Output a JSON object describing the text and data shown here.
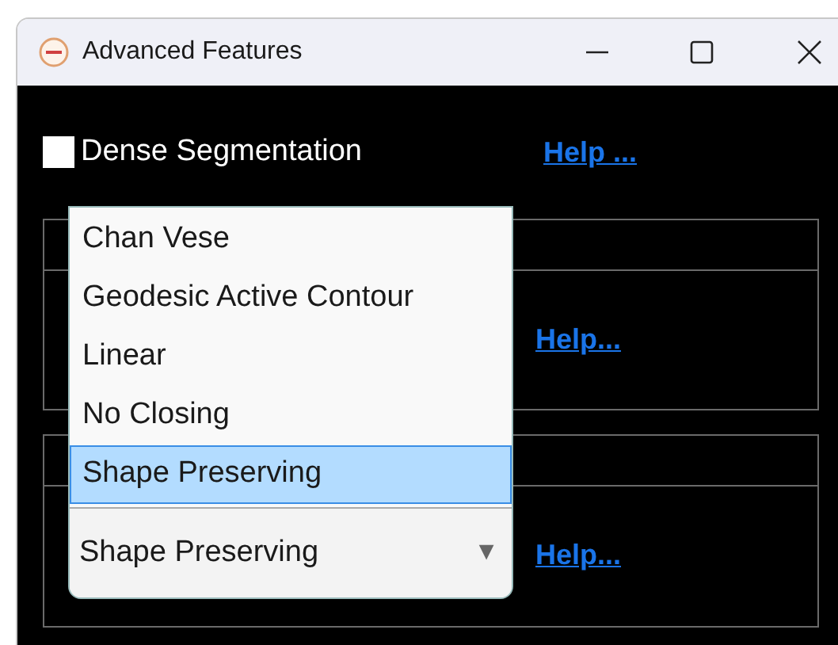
{
  "window": {
    "title": "Advanced Features"
  },
  "dense_segmentation": {
    "label": "Dense Segmentation",
    "checked": false,
    "help": "Help ..."
  },
  "groups": [
    {
      "help": "Help..."
    },
    {
      "help": "Help..."
    }
  ],
  "dropdown": {
    "value": "Shape Preserving",
    "arrow": "▼",
    "options": [
      {
        "label": "Chan Vese",
        "selected": false
      },
      {
        "label": "Geodesic Active Contour",
        "selected": false
      },
      {
        "label": "Linear",
        "selected": false
      },
      {
        "label": "No Closing",
        "selected": false
      },
      {
        "label": "Shape Preserving",
        "selected": true
      }
    ]
  }
}
